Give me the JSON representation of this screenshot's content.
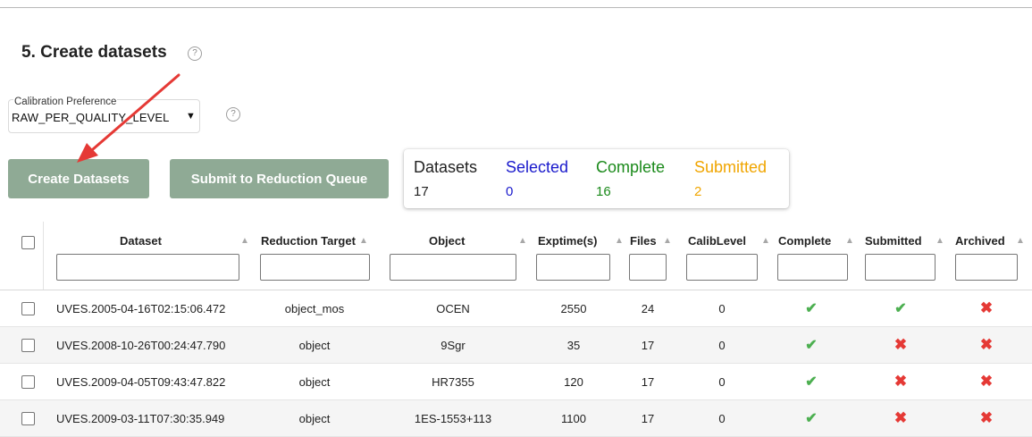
{
  "section": {
    "title": "5. Create datasets",
    "help_icon": "?"
  },
  "calibration": {
    "label": "Calibration Preference",
    "value": "RAW_PER_QUALITY_LEVEL",
    "caret": "▼",
    "help_icon": "?"
  },
  "buttons": {
    "create": "Create Datasets",
    "submit": "Submit to Reduction Queue"
  },
  "stats": [
    {
      "label": "Datasets",
      "value": "17",
      "color": "#222222"
    },
    {
      "label": "Selected",
      "value": "0",
      "color": "#1a1acc"
    },
    {
      "label": "Complete",
      "value": "16",
      "color": "#1b8a1b"
    },
    {
      "label": "Submitted",
      "value": "2",
      "color": "#f0a500"
    }
  ],
  "table": {
    "sort_icon": "▲",
    "columns": [
      "Dataset",
      "Reduction Target",
      "Object",
      "Exptime(s)",
      "Files",
      "CalibLevel",
      "Complete",
      "Submitted",
      "Archived"
    ],
    "rows": [
      {
        "dataset": "UVES.2005-04-16T02:15:06.472",
        "target": "object_mos",
        "object": "OCEN",
        "exptime": "2550",
        "files": "24",
        "calib": "0",
        "complete": true,
        "submitted": true,
        "archived": false
      },
      {
        "dataset": "UVES.2008-10-26T00:24:47.790",
        "target": "object",
        "object": "9Sgr",
        "exptime": "35",
        "files": "17",
        "calib": "0",
        "complete": true,
        "submitted": false,
        "archived": false
      },
      {
        "dataset": "UVES.2009-04-05T09:43:47.822",
        "target": "object",
        "object": "HR7355",
        "exptime": "120",
        "files": "17",
        "calib": "0",
        "complete": true,
        "submitted": false,
        "archived": false
      },
      {
        "dataset": "UVES.2009-03-11T07:30:35.949",
        "target": "object",
        "object": "1ES-1553+113",
        "exptime": "1100",
        "files": "17",
        "calib": "0",
        "complete": true,
        "submitted": false,
        "archived": false
      }
    ]
  },
  "icons": {
    "check": "✔",
    "cross": "✖"
  },
  "annotation": {
    "arrow_color": "#e53935"
  }
}
